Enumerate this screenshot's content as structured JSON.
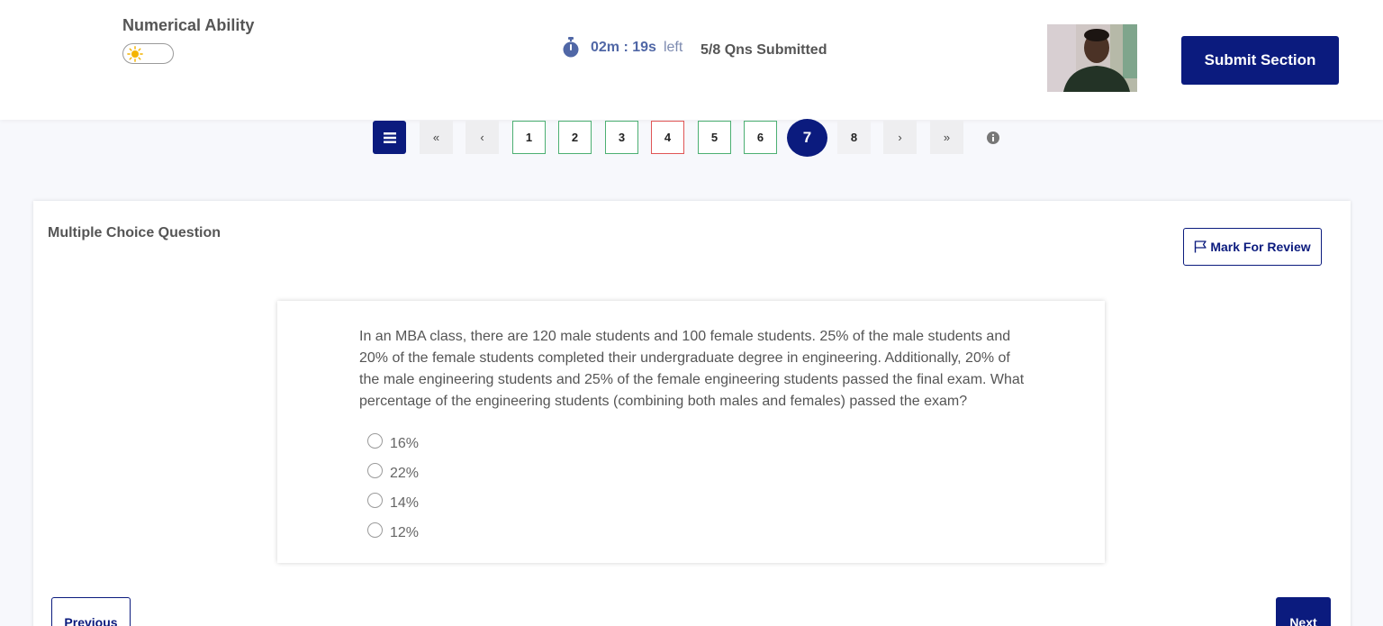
{
  "header": {
    "section_title": "Numerical Ability",
    "theme_toggle_icon": "sun-icon",
    "timer_icon": "stopwatch-icon",
    "timer_value": "02m : 19s",
    "timer_suffix": "left",
    "submitted_status": "5/8 Qns Submitted",
    "submit_label": "Submit Section"
  },
  "pager": {
    "list_icon": "list-icon",
    "first": "«",
    "prev": "‹",
    "next": "›",
    "last": "»",
    "questions": [
      {
        "label": "1",
        "status": "answered"
      },
      {
        "label": "2",
        "status": "answered"
      },
      {
        "label": "3",
        "status": "answered"
      },
      {
        "label": "4",
        "status": "skipped"
      },
      {
        "label": "5",
        "status": "answered"
      },
      {
        "label": "6",
        "status": "answered"
      },
      {
        "label": "7",
        "status": "current"
      },
      {
        "label": "8",
        "status": "not-visited"
      }
    ],
    "info_icon": "info-icon"
  },
  "question": {
    "type_label": "Multiple Choice Question",
    "review_label": "Mark For Review",
    "review_icon": "flag-icon",
    "text": "In an MBA class, there are 120 male students and 100 female students. 25% of the male students and 20% of the female students completed their undergraduate degree in engineering. Additionally, 20% of the male engineering students and 25% of the female engineering students passed the final exam. What percentage of the engineering students (combining both males and females) passed the exam?",
    "options": [
      "16%",
      "22%",
      "14%",
      "12%"
    ]
  },
  "footer": {
    "previous_label": "Previous",
    "next_label": "Next"
  },
  "colors": {
    "primary": "#0b1b7e",
    "answered_border": "#4caf72",
    "skipped_border": "#e05555",
    "timer_text": "#5067a6"
  }
}
